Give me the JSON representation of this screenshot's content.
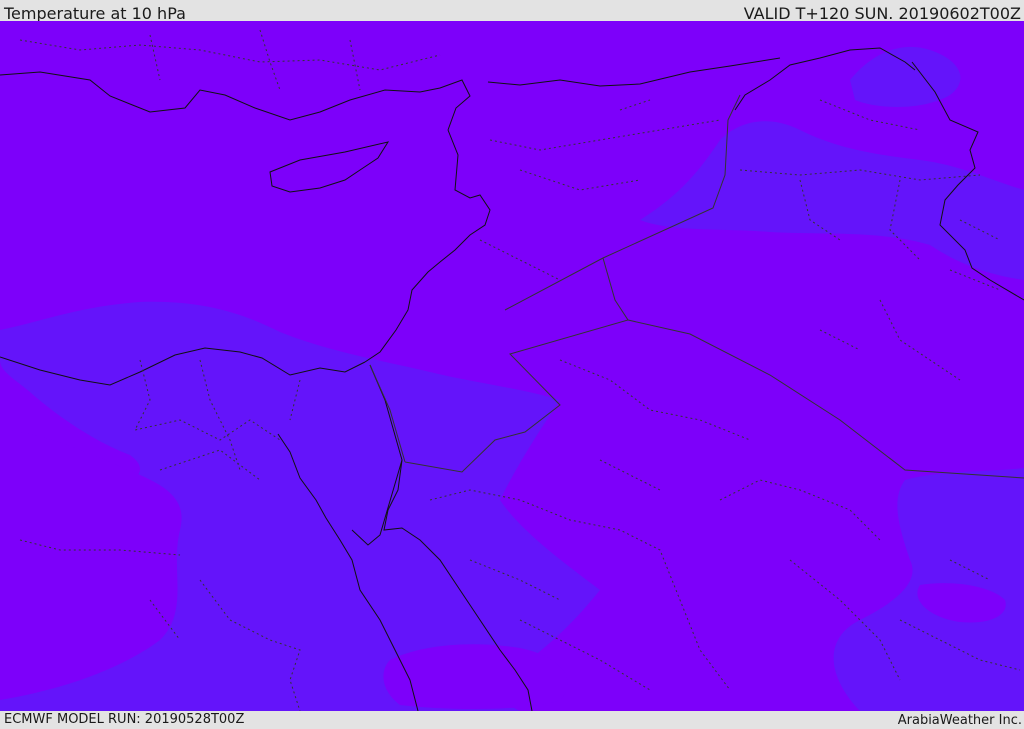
{
  "header": {
    "title": "Temperature at 10 hPa",
    "valid": "VALID T+120 SUN. 20190602T00Z"
  },
  "footer": {
    "model_run": "ECMWF MODEL RUN: 20190528T00Z",
    "brand": "ArabiaWeather Inc."
  },
  "map": {
    "region": "Eastern Mediterranean / Middle East",
    "colors": {
      "field_warm": "#7d00fa",
      "field_cool": "#6414fa",
      "coast_line": "#111111",
      "border_line": "#333333"
    },
    "layers": [
      "temperature-field",
      "coastlines",
      "country-borders",
      "province-borders"
    ]
  }
}
